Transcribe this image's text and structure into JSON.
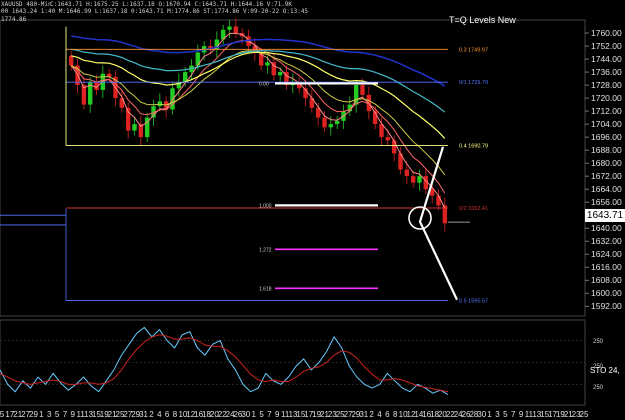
{
  "header": {
    "symbol": "XAUUSD 480-Min",
    "ohlc": "C:1643.71  H:1675.25  L:1637.18  O:1670.94  C:1643.71  H:1644.16  V:71.9K",
    "line2": "00 1643.24 1:40  M:1646.99  L:1637.18  0:1643.71  M:1774.86  ST:1774.86  V:09-20-22  O:13:45",
    "line3": "1774.86"
  },
  "title": "T=Q Levels New",
  "last_price": "1643.71",
  "colors": {
    "background": "#000000",
    "candle_up": "#22cc22",
    "candle_down": "#dd2222",
    "ema_fast": "#ff8888",
    "ema_mid": "#cccc44",
    "ema_slow": "#ffff66",
    "ema_blue": "#2233cc",
    "ema_cyan": "#44bbcc",
    "level_yellow": "#ffff88",
    "level_orange": "#ff9933",
    "level_blue": "#5577ff",
    "level_magenta": "#ff33ff",
    "stoch_k": "#66ccff",
    "stoch_d": "#cc2222"
  },
  "chart_data": [
    {
      "type": "candlestick",
      "title": "T=Q Levels New",
      "ylim": [
        1586,
        1768
      ],
      "yticks": [
        "1760.00",
        "1752.00",
        "1744.00",
        "1736.00",
        "1728.00",
        "1720.00",
        "1712.00",
        "1704.00",
        "1696.00",
        "1688.00",
        "1680.00",
        "1672.00",
        "1664.00",
        "1656.00",
        "1648.00",
        "1640.00",
        "1632.00",
        "1624.00",
        "1616.00",
        "1608.00",
        "1600.00",
        "1592.00"
      ],
      "close": [
        1740,
        1728,
        1716,
        1730,
        1725,
        1735,
        1733,
        1720,
        1714,
        1700,
        1704,
        1696,
        1708,
        1715,
        1718,
        1713,
        1726,
        1730,
        1736,
        1740,
        1748,
        1752,
        1750,
        1756,
        1762,
        1764,
        1760,
        1758,
        1752,
        1748,
        1740,
        1742,
        1734,
        1736,
        1728,
        1730,
        1726,
        1720,
        1714,
        1708,
        1702,
        1704,
        1706,
        1712,
        1716,
        1728,
        1722,
        1712,
        1704,
        1696,
        1694,
        1686,
        1676,
        1672,
        1668,
        1672,
        1664,
        1660,
        1654,
        1643
      ],
      "levels": [
        {
          "label": "0.3 1749.97",
          "value": 1749.97,
          "color": "#ff9933"
        },
        {
          "label": "0/1 1729.79",
          "value": 1729.79,
          "color": "#5577ff"
        },
        {
          "label": "0.4 1690.79",
          "value": 1690.79,
          "color": "#ffff88"
        },
        {
          "label": "0/2 1652.41",
          "value": 1652.41,
          "color": "#cc3333"
        },
        {
          "label": "0.5 1595.57",
          "value": 1595.57,
          "color": "#5577ff"
        }
      ],
      "fib_labels": [
        {
          "label": "1.000",
          "value": 1654
        },
        {
          "label": "0.00",
          "value": 1729
        },
        {
          "label": "1.272",
          "value": 1627
        },
        {
          "label": "1.618",
          "value": 1603
        }
      ]
    },
    {
      "type": "line",
      "title": "STO",
      "yticks": [
        "250",
        "250",
        "250"
      ],
      "label": "STO 24,",
      "ylim": [
        0,
        100
      ],
      "series": [
        {
          "color": "#66ccff",
          "values": [
            40,
            20,
            10,
            25,
            15,
            30,
            20,
            35,
            22,
            12,
            20,
            30,
            18,
            10,
            25,
            40,
            60,
            75,
            90,
            98,
            85,
            95,
            80,
            70,
            88,
            92,
            70,
            60,
            75,
            80,
            55,
            40,
            20,
            10,
            15,
            35,
            25,
            20,
            30,
            45,
            55,
            40,
            50,
            65,
            85,
            70,
            45,
            30,
            20,
            15,
            20,
            35,
            25,
            15,
            10,
            20,
            15,
            8,
            12,
            6
          ]
        },
        {
          "color": "#cc2222",
          "values": [
            35,
            30,
            25,
            22,
            20,
            22,
            24,
            26,
            24,
            20,
            20,
            22,
            22,
            20,
            22,
            28,
            40,
            55,
            68,
            78,
            85,
            88,
            86,
            82,
            82,
            84,
            80,
            74,
            72,
            72,
            66,
            58,
            46,
            34,
            26,
            24,
            26,
            24,
            24,
            30,
            38,
            42,
            44,
            50,
            60,
            66,
            64,
            56,
            44,
            34,
            26,
            26,
            28,
            26,
            22,
            18,
            16,
            14,
            12,
            10
          ]
        }
      ]
    }
  ],
  "x_axis": [
    "5",
    "17",
    "21",
    "27",
    "29",
    "1",
    "3",
    "5",
    "7",
    "9",
    "11",
    "13",
    "15",
    "19",
    "21",
    "25",
    "27",
    "29",
    "31",
    "2",
    "4",
    "6",
    "8",
    "10",
    "12",
    "16",
    "18",
    "20",
    "22",
    "24",
    "26",
    "30",
    "1",
    "5",
    "7",
    "9",
    "11",
    "13",
    "15",
    "17",
    "19",
    "21",
    "23",
    "25",
    "27",
    "29",
    "31",
    "2",
    "4",
    "6",
    "8",
    "10",
    "12",
    "14",
    "16",
    "18",
    "20",
    "22",
    "24",
    "26",
    "28",
    "30",
    "1",
    "3",
    "5",
    "7",
    "9",
    "11",
    "13",
    "15",
    "17",
    "19",
    "21",
    "23",
    "25"
  ]
}
